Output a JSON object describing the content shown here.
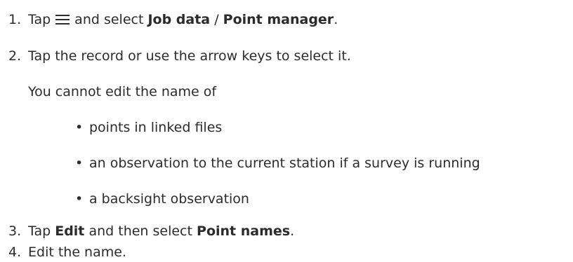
{
  "steps": [
    {
      "number": "1.",
      "tap": "Tap",
      "icon": "hamburger-menu-icon",
      "and_select": "and select",
      "menu_path_1": "Job data",
      "separator": "/",
      "menu_path_2": "Point manager",
      "end": "."
    },
    {
      "number": "2.",
      "text": "Tap the record or use the arrow keys to select it.",
      "note": "You cannot edit the name of",
      "bullets": [
        "points in linked files",
        "an observation to the current station if a survey is running",
        "a backsight observation"
      ],
      "bullet_glyph": "•"
    },
    {
      "number": "3.",
      "tap": "Tap",
      "button": "Edit",
      "then_select": "and then select",
      "option": "Point names",
      "end": "."
    },
    {
      "number": "4.",
      "text": "Edit the name."
    }
  ]
}
